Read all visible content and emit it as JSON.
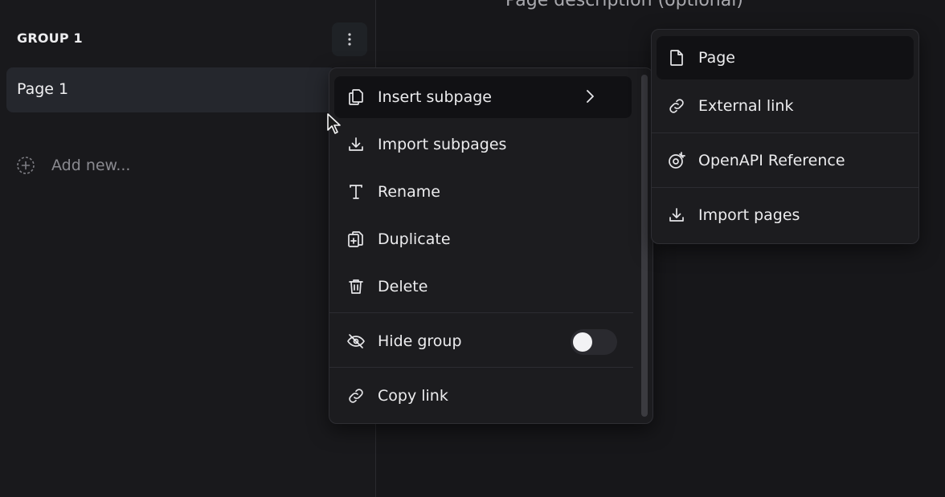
{
  "sidebar": {
    "group_header": "GROUP 1",
    "page_item": "Page 1",
    "add_new": "Add new..."
  },
  "main": {
    "title": "Page description (optional)"
  },
  "context_menu": {
    "items": [
      {
        "label": "Insert subpage",
        "icon": "subpage-icon",
        "has_submenu": true,
        "active": true
      },
      {
        "label": "Import subpages",
        "icon": "download-icon"
      },
      {
        "label": "Rename",
        "icon": "text-icon"
      },
      {
        "label": "Duplicate",
        "icon": "duplicate-icon"
      },
      {
        "label": "Delete",
        "icon": "trash-icon"
      },
      {
        "label": "Hide group",
        "icon": "eye-off-icon",
        "toggle": false
      },
      {
        "label": "Copy link",
        "icon": "link-icon"
      }
    ]
  },
  "submenu": {
    "items": [
      {
        "label": "Page",
        "icon": "page-icon",
        "active": true
      },
      {
        "label": "External link",
        "icon": "link-icon"
      },
      {
        "label": "OpenAPI Reference",
        "icon": "openapi-icon"
      },
      {
        "label": "Import pages",
        "icon": "download-icon"
      }
    ]
  },
  "colors": {
    "background": "#17171a",
    "menu_background": "#1c1c1f",
    "active_item": "#111114",
    "selected_page": "#25272d",
    "text": "#ececee",
    "muted_text": "#8a8a90"
  }
}
